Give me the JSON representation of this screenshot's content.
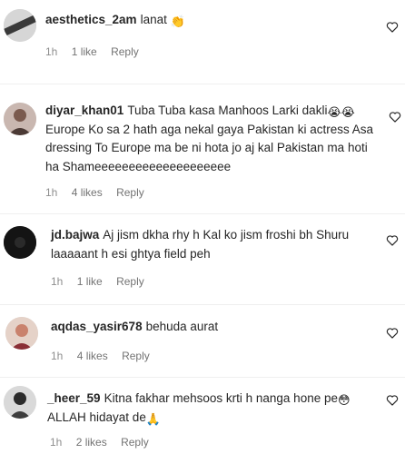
{
  "comments": [
    {
      "username": "aesthetics_2am",
      "text": "lanat",
      "emoji": "👏",
      "time": "1h",
      "likes": "1 like",
      "reply": "Reply"
    },
    {
      "username": "diyar_khan01",
      "text": "Tuba Tuba kasa Manhoos Larki dakli",
      "emoji": "😭😭",
      "text_cont": "Europe Ko sa 2 hath aga nekal gaya Pakistan ki actress Asa dressing To Europe ma be ni hota jo aj kal Pakistan ma hoti ha Shameeeeeeeeeeeeeeeeeeee",
      "time": "1h",
      "likes": "4 likes",
      "reply": "Reply"
    },
    {
      "username": "jd.bajwa",
      "text": "Aj jism dkha rhy h Kal ko jism froshi bh Shuru laaaaant h esi ghtya field peh",
      "time": "1h",
      "likes": "1 like",
      "reply": "Reply"
    },
    {
      "username": "aqdas_yasir678",
      "text": "behuda aurat",
      "time": "1h",
      "likes": "4 likes",
      "reply": "Reply"
    },
    {
      "username": "_heer_59",
      "text": "Kitna fakhar mehsoos krti h nanga hone pe",
      "emoji": "😳",
      "text_cont": "ALLAH hidayat de",
      "emoji2": "🙏",
      "time": "1h",
      "likes": "2 likes",
      "reply": "Reply"
    }
  ]
}
